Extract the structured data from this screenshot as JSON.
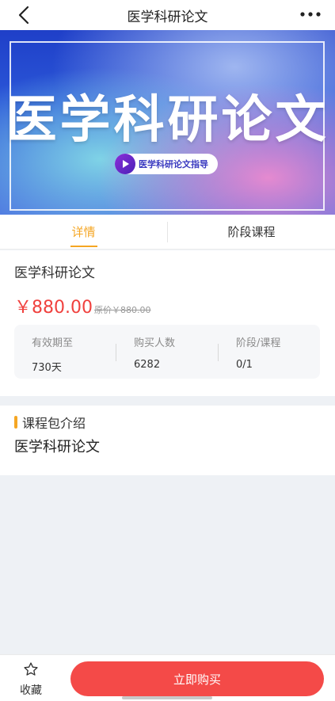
{
  "header": {
    "title": "医学科研论文",
    "back_icon": "chevron-left-icon",
    "more_icon": "more-dots-icon"
  },
  "banner": {
    "title": "医学科研论文",
    "pill_label": "医学科研论文指导",
    "play_icon": "play-icon"
  },
  "tabs": [
    {
      "label": "详情",
      "active": true
    },
    {
      "label": "阶段课程",
      "active": false
    }
  ],
  "course": {
    "name": "医学科研论文",
    "price": "￥880.00",
    "original_price": "原价￥880.00"
  },
  "stats": [
    {
      "label": "有效期至",
      "value": "730天"
    },
    {
      "label": "购买人数",
      "value": "6282"
    },
    {
      "label": "阶段/课程",
      "value": "0/1"
    }
  ],
  "intro": {
    "title": "课程包介绍",
    "content": "医学科研论文"
  },
  "bottom_bar": {
    "favorite_label": "收藏",
    "favorite_icon": "star-outline-icon",
    "buy_label": "立即购买"
  },
  "colors": {
    "accent": "#f5a623",
    "price_red": "#f0413e",
    "buy_button": "#f44a48"
  }
}
